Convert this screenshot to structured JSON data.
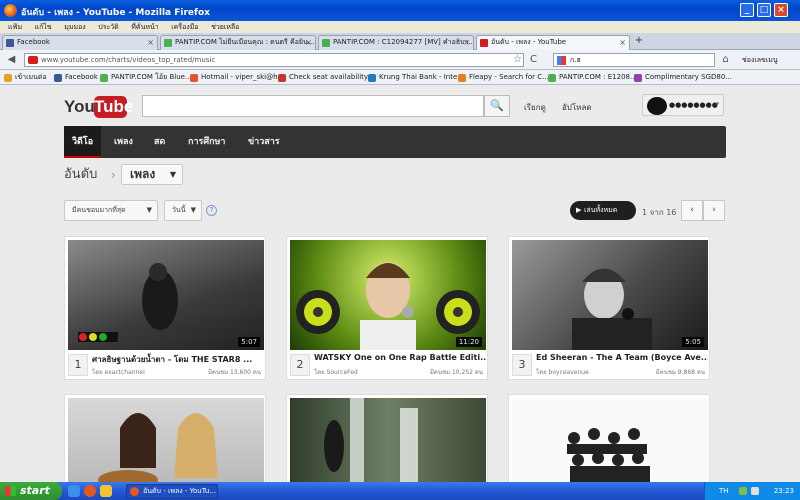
{
  "window": {
    "title": "อันดับ - เพลง - YouTube - Mozilla Firefox",
    "minimize": "_",
    "maximize": "□",
    "close": "×"
  },
  "menu": [
    "แฟ้ม",
    "แก้ไข",
    "มุมมอง",
    "ประวัติ",
    "ที่คั่นหน้า",
    "เครื่องมือ",
    "ช่วยเหลือ"
  ],
  "tabs": [
    {
      "label": "Facebook",
      "color": "#3b5998"
    },
    {
      "label": "PANTIP.COM ไม่ยืนเมือนคุณ : ดนตรี คือยิน...",
      "color": "#4caf50"
    },
    {
      "label": "PANTIP.COM : C12094277 [MV] คำอธิบา...",
      "color": "#4caf50"
    },
    {
      "label": "อันดับ - เพลง - YouTube",
      "color": "#d21e1e"
    }
  ],
  "new_tab": "+",
  "nav": {
    "back": "◀",
    "forward": "▶",
    "url": "www.youtube.com/charts/videos_top_rated/music",
    "search_value": "ก.ฮ",
    "reload": "C",
    "star": "☆",
    "home": "⌂",
    "extra": "ช่องเลขเมนู"
  },
  "bookmarks": [
    {
      "label": "เข้าเมนต่อ",
      "color": "#e8a020"
    },
    {
      "label": "Facebook",
      "color": "#3b5998"
    },
    {
      "label": "PANTIP.COM โอ้ย Blue...",
      "color": "#4caf50"
    },
    {
      "label": "Hotmail - viper_ski@h...",
      "color": "#e0552e"
    },
    {
      "label": "Check seat availability...",
      "color": "#c0392b"
    },
    {
      "label": "Krung Thai Bank - Inte...",
      "color": "#1f7acb"
    },
    {
      "label": "Fleapy - Search for C...",
      "color": "#e67e22"
    },
    {
      "label": "PANTIP.COM : E1208...",
      "color": "#4caf50"
    },
    {
      "label": "Complimentary SGD80...",
      "color": "#8e44ad"
    }
  ],
  "youtube": {
    "logo_you": "You",
    "logo_tube": "Tube",
    "search_icon": "🔍",
    "browse": "เรียกดู",
    "upload": "อัปโหลด",
    "user_name": "●●●●●●●●",
    "guide_tabs": [
      "วิดีโอ",
      "เพลง",
      "สด",
      "การศึกษา",
      "ข่าวสาร"
    ],
    "breadcrumb": "อันดับ",
    "breadcrumb_sep": "›",
    "category": "เพลง",
    "filter_sort": "มีคนชอบมากที่สุด",
    "filter_time": "วันนี้",
    "help": "?",
    "play_all": "เล่นทั้งหมด",
    "pager_text": "1 จาก 16",
    "prev": "‹",
    "next": "›",
    "videos": [
      {
        "rank": "1",
        "title": "ศาลธิษฐานด้วยน้ำตา - โดม THE STAR8 ...",
        "by": "โดย exactchannel",
        "views": "มีคนชม 13,600 คน",
        "duration": "5:07"
      },
      {
        "rank": "2",
        "title": "WATSKY One on One Rap Battle Editi...",
        "by": "โดย SourceFed",
        "views": "มีคนชม 10,252 คน",
        "duration": "11:20"
      },
      {
        "rank": "3",
        "title": "Ed Sheeran - The A Team (Boyce Ave...",
        "by": "โดย boyceavenue",
        "views": "มีคนชม 9,868 คน",
        "duration": "5:05"
      }
    ]
  },
  "taskbar": {
    "start": "start",
    "active_item": "อันดับ - เพลง - YouTu...",
    "lang": "TH",
    "clock": "23:23"
  }
}
